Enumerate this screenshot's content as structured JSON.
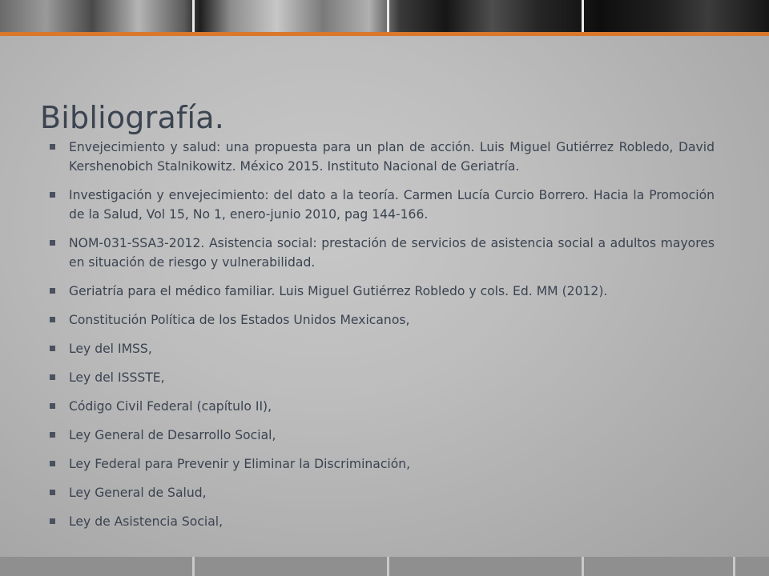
{
  "slide": {
    "title": "Bibliografía.",
    "bullets": [
      "Envejecimiento y salud: una propuesta para un plan de acción. Luis Miguel Gutiérrez Robledo, David Kershenobich Stalnikowitz. México 2015. Instituto Nacional de Geriatría.",
      "Investigación y envejecimiento: del dato a la teoría. Carmen Lucía Curcio Borrero. Hacia la Promoción de la Salud, Vol 15, No 1, enero-junio 2010, pag 144-166.",
      "NOM-031-SSA3-2012. Asistencia social: prestación de servicios de asistencia social a adultos mayores en situación de riesgo y vulnerabilidad.",
      "Geriatría para el médico familiar. Luis Miguel Gutiérrez Robledo y cols. Ed. MM (2012).",
      "Constitución Política de los Estados Unidos Mexicanos,",
      "Ley del IMSS,",
      "Ley del ISSSTE,",
      "Código Civil Federal (capítulo II),",
      "Ley General de Desarrollo Social,",
      "Ley Federal para Prevenir y Eliminar la Discriminación,",
      "Ley General de Salud,",
      "Ley de Asistencia Social,"
    ]
  },
  "colors": {
    "accent": "#d9782c",
    "title": "#3c4450",
    "body_text": "#3b4351",
    "background": "#bdbdbd"
  },
  "icons": {
    "bullet": "square-bullet-icon"
  }
}
